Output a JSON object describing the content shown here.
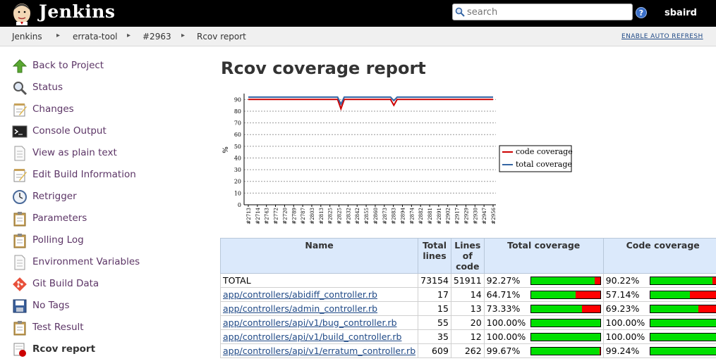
{
  "header": {
    "brand": "Jenkins",
    "user": "sbaird",
    "help_label": "?"
  },
  "search": {
    "placeholder": "search"
  },
  "breadcrumbs": [
    "Jenkins",
    "errata-tool",
    "#2963",
    "Rcov report"
  ],
  "auto_refresh": "ENABLE AUTO REFRESH",
  "sidebar": [
    {
      "label": "Back to Project",
      "icon": "up-arrow-icon"
    },
    {
      "label": "Status",
      "icon": "magnifier-icon"
    },
    {
      "label": "Changes",
      "icon": "notepad-icon"
    },
    {
      "label": "Console Output",
      "icon": "terminal-icon"
    },
    {
      "label": "View as plain text",
      "icon": "document-icon"
    },
    {
      "label": "Edit Build Information",
      "icon": "notepad-icon"
    },
    {
      "label": "Retrigger",
      "icon": "clock-icon"
    },
    {
      "label": "Parameters",
      "icon": "clipboard-icon"
    },
    {
      "label": "Polling Log",
      "icon": "clipboard-icon"
    },
    {
      "label": "Environment Variables",
      "icon": "document-icon"
    },
    {
      "label": "Git Build Data",
      "icon": "git-icon"
    },
    {
      "label": "No Tags",
      "icon": "floppy-icon"
    },
    {
      "label": "Test Result",
      "icon": "clipboard-icon"
    },
    {
      "label": "Rcov report",
      "icon": "rcov-icon",
      "active": true
    }
  ],
  "page_title": "Rcov coverage report",
  "chart_data": {
    "type": "line",
    "ylabel": "%",
    "ylim": [
      0,
      95
    ],
    "yticks": [
      0,
      10,
      20,
      30,
      40,
      50,
      60,
      70,
      80,
      90
    ],
    "grid": true,
    "legend_position": "right",
    "x": [
      "#2713",
      "#2714",
      "#2715",
      "#2716",
      "#2717",
      "#2718",
      "#2719",
      "#2720",
      "#2721",
      "#2722",
      "#2723",
      "#2724",
      "#2725",
      "#2726",
      "#2727",
      "#2728",
      "#2729",
      "#2730",
      "#2731",
      "#2732",
      "#2733",
      "#2734",
      "#2735",
      "#2736",
      "#2737",
      "#2738",
      "#2739",
      "#2740",
      "#2741",
      "#2742",
      "#2743",
      "#2744",
      "#2745",
      "#2746",
      "#2747",
      "#2748",
      "#2749",
      "#2750",
      "#2751",
      "#2752",
      "#2753",
      "#2754",
      "#2755",
      "#2756",
      "#2757",
      "#2758",
      "#2759",
      "#2760",
      "#2761",
      "#2762",
      "#2763",
      "#2764",
      "#2765",
      "#2766",
      "#2767",
      "#2768",
      "#2769",
      "#2770",
      "#2771",
      "#2772",
      "#2773",
      "#2774",
      "#2775",
      "#2776",
      "#2777",
      "#2778",
      "#2779",
      "#2780",
      "#2781",
      "#2782",
      "#2783",
      "#2784",
      "#2785",
      "#2786",
      "#2787"
    ],
    "series": [
      {
        "name": "code coverage",
        "color": "#cc0000",
        "values": [
          90,
          90,
          90,
          90,
          90,
          90,
          90,
          90,
          90,
          90,
          90,
          90,
          90,
          90,
          90,
          90,
          90,
          90,
          90,
          90,
          90,
          90,
          90,
          90,
          90,
          90,
          90,
          90,
          90,
          90,
          90,
          90,
          90,
          90,
          90,
          90,
          90,
          90,
          90,
          90,
          90,
          90,
          90,
          90,
          90,
          90,
          90,
          90,
          90,
          90,
          90,
          90,
          90,
          90,
          90,
          90,
          90,
          90,
          90,
          90,
          90,
          90,
          90,
          90,
          90,
          90,
          90,
          90,
          90,
          90,
          90,
          90,
          90,
          90,
          90
        ]
      },
      {
        "name": "total coverage",
        "color": "#3465a4",
        "values": [
          92,
          92,
          92,
          92,
          92,
          92,
          92,
          92,
          92,
          92,
          92,
          92,
          92,
          92,
          92,
          92,
          92,
          92,
          92,
          92,
          92,
          92,
          92,
          92,
          92,
          92,
          92,
          92,
          92,
          92,
          92,
          92,
          92,
          92,
          92,
          92,
          92,
          92,
          92,
          92,
          92,
          92,
          92,
          92,
          92,
          92,
          92,
          92,
          92,
          92,
          92,
          92,
          92,
          92,
          92,
          92,
          92,
          92,
          92,
          92,
          92,
          92,
          92,
          92,
          92,
          92,
          92,
          92,
          92,
          92,
          92,
          92,
          92,
          92,
          92
        ]
      }
    ],
    "x_tick_labels": [
      "#2713",
      "#2714",
      "#2743",
      "#2772",
      "#2720",
      "#2789",
      "#2787",
      "#2803",
      "#2813",
      "#2825",
      "#2825",
      "#2832",
      "#2842",
      "#2855",
      "#2860",
      "#2873",
      "#2883",
      "#2894",
      "#2874",
      "#2882",
      "#2881",
      "#2891",
      "#2902",
      "#2917",
      "#2929",
      "#2930",
      "#2947",
      "#2956"
    ]
  },
  "table": {
    "headers": [
      "Name",
      "Total lines",
      "Lines of code",
      "Total coverage",
      "Code coverage"
    ],
    "rows": [
      {
        "name": "TOTAL",
        "link": false,
        "total_lines": "73154",
        "loc": "51911",
        "total_cov": "92.27%",
        "total_frac": 0.9227,
        "code_cov": "90.22%",
        "code_frac": 0.9022
      },
      {
        "name": "app/controllers/abidiff_controller.rb",
        "link": true,
        "total_lines": "17",
        "loc": "14",
        "total_cov": "64.71%",
        "total_frac": 0.6471,
        "code_cov": "57.14%",
        "code_frac": 0.5714
      },
      {
        "name": "app/controllers/admin_controller.rb",
        "link": true,
        "total_lines": "15",
        "loc": "13",
        "total_cov": "73.33%",
        "total_frac": 0.7333,
        "code_cov": "69.23%",
        "code_frac": 0.6923
      },
      {
        "name": "app/controllers/api/v1/bug_controller.rb",
        "link": true,
        "total_lines": "55",
        "loc": "20",
        "total_cov": "100.00%",
        "total_frac": 1.0,
        "code_cov": "100.00%",
        "code_frac": 1.0
      },
      {
        "name": "app/controllers/api/v1/build_controller.rb",
        "link": true,
        "total_lines": "35",
        "loc": "12",
        "total_cov": "100.00%",
        "total_frac": 1.0,
        "code_cov": "100.00%",
        "code_frac": 1.0
      },
      {
        "name": "app/controllers/api/v1/erratum_controller.rb",
        "link": true,
        "total_lines": "609",
        "loc": "262",
        "total_cov": "99.67%",
        "total_frac": 0.9967,
        "code_cov": "99.24%",
        "code_frac": 0.9924
      }
    ]
  }
}
